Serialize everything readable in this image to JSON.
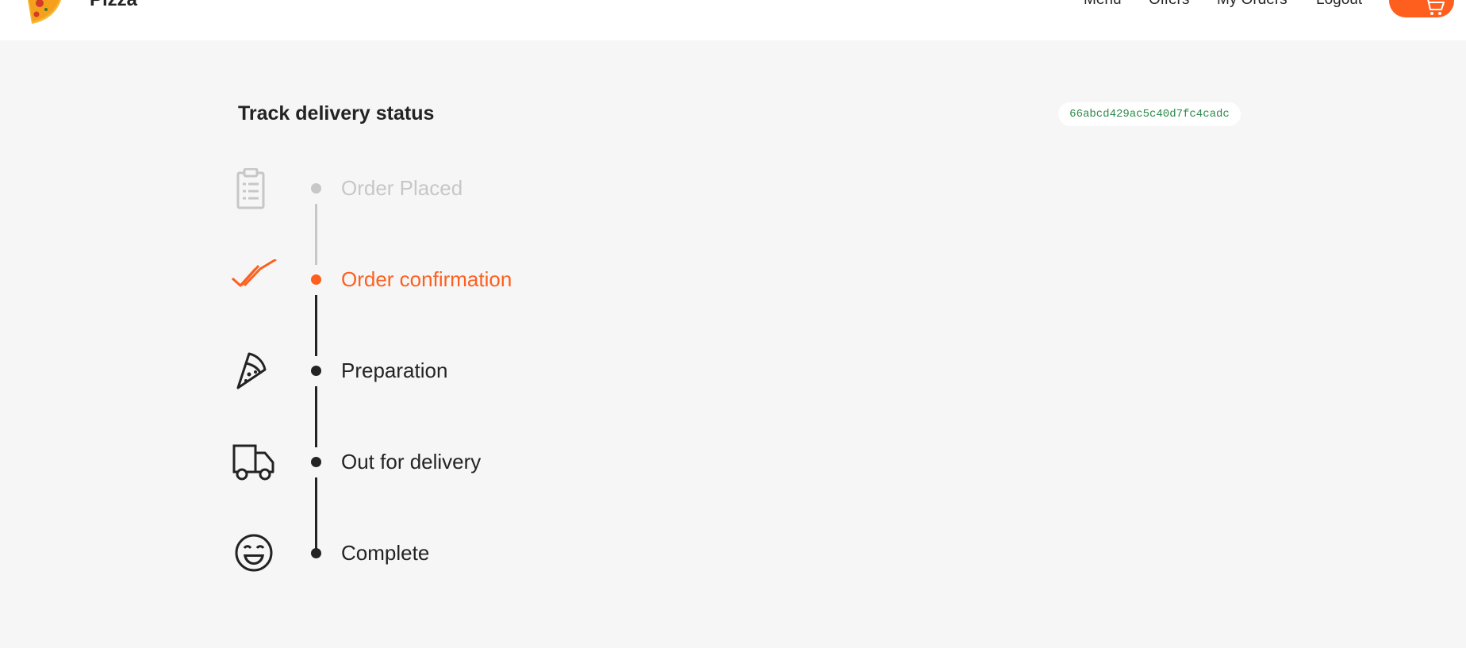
{
  "header": {
    "brand": "Pizza",
    "nav": {
      "menu": "Menu",
      "offers": "Offers",
      "my_orders": "My Orders",
      "logout": "Logout"
    },
    "cart_icon": "cart-icon",
    "logo_icon": "pizza-logo-icon"
  },
  "main": {
    "title": "Track delivery status",
    "order_id": "66abcd429ac5c40d7fc4cadc"
  },
  "timeline": {
    "steps": [
      {
        "label": "Order Placed",
        "icon": "clipboard-icon",
        "state": "done"
      },
      {
        "label": "Order confirmation",
        "icon": "double-check-icon",
        "state": "current"
      },
      {
        "label": "Preparation",
        "icon": "pizza-slice-icon",
        "state": "pending"
      },
      {
        "label": "Out for delivery",
        "icon": "truck-icon",
        "state": "pending"
      },
      {
        "label": "Complete",
        "icon": "smile-icon",
        "state": "pending"
      }
    ]
  },
  "colors": {
    "accent": "#fe5f1e",
    "done": "#c7c7c7",
    "pending": "#232323",
    "order_id_text": "#2b8a4a",
    "background": "#f6f6f6"
  }
}
